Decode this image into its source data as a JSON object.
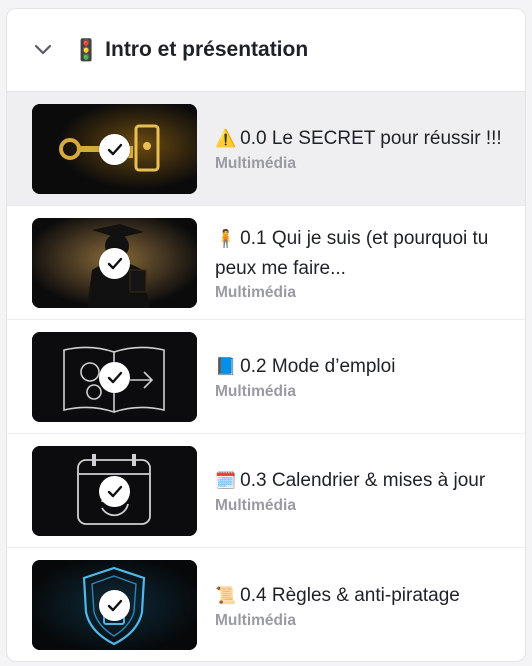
{
  "section": {
    "emoji": "🚦",
    "title": "Intro et présentation",
    "chevron_icon": "chevron-down-icon"
  },
  "lessons": [
    {
      "emoji": "⚠️",
      "title": "0.0 Le SECRET pour réussir !!!",
      "type": "Multimédia",
      "completed": true,
      "thumbnail_icon": "golden-key-icon",
      "active": true
    },
    {
      "emoji": "🧍",
      "title": "0.1 Qui je suis (et pourquoi tu peux me faire...",
      "type": "Multimédia",
      "completed": true,
      "thumbnail_icon": "graduate-silhouette-icon",
      "active": false
    },
    {
      "emoji": "📘",
      "title": "0.2 Mode d’emploi",
      "type": "Multimédia",
      "completed": true,
      "thumbnail_icon": "book-gears-icon",
      "active": false
    },
    {
      "emoji": "🗓️",
      "title": "0.3 Calendrier & mises à jour",
      "type": "Multimédia",
      "completed": true,
      "thumbnail_icon": "calendar-refresh-icon",
      "active": false
    },
    {
      "emoji": "📜",
      "title": "0.4 Règles & anti-piratage",
      "type": "Multimédia",
      "completed": true,
      "thumbnail_icon": "shield-lock-icon",
      "active": false
    }
  ],
  "colors": {
    "active_row": "#efeff2",
    "title_text": "#1f2128",
    "meta_text": "#9a9aa2",
    "key_gold": "#c9a13c",
    "shield_blue": "#4fb8e6"
  }
}
